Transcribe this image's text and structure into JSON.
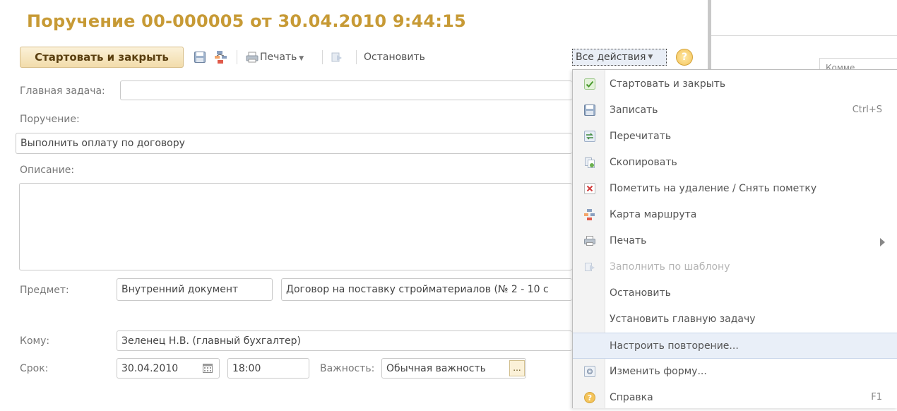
{
  "title": "Поручение 00-000005 от 30.04.2010 9:44:15",
  "toolbar": {
    "start_close": "Стартовать и закрыть",
    "print": "Печать",
    "stop": "Остановить",
    "all_actions": "Все действия",
    "help": "?"
  },
  "form": {
    "main_task_label": "Главная задача:",
    "main_task_value": "",
    "assignment_label": "Поручение:",
    "assignment_value": "Выполнить оплату по договору",
    "description_label": "Описание:",
    "description_value": "",
    "subject_label": "Предмет:",
    "subject_type": "Внутренний документ",
    "subject_value": "Договор на поставку стройматериалов (№ 2 - 10 с",
    "to_label": "Кому:",
    "to_value": "Зеленец Н.В. (главный бухгалтер)",
    "deadline_label": "Срок:",
    "deadline_date": "30.04.2010",
    "deadline_time": "18:00",
    "importance_label": "Важность:",
    "importance_value": "Обычная важность",
    "ellipsis": "..."
  },
  "right_panel": {
    "column_header": "Комме"
  },
  "menu": {
    "items": [
      {
        "label": "Стартовать и закрыть",
        "icon": "check-icon",
        "shortcut": "",
        "disabled": false
      },
      {
        "label": "Записать",
        "icon": "save-icon",
        "shortcut": "Ctrl+S",
        "disabled": false
      },
      {
        "label": "Перечитать",
        "icon": "refresh-icon",
        "shortcut": "",
        "disabled": false
      },
      {
        "label": "Скопировать",
        "icon": "copy-icon",
        "shortcut": "",
        "disabled": false
      },
      {
        "label": "Пометить на удаление / Снять пометку",
        "icon": "delete-mark-icon",
        "shortcut": "",
        "disabled": false
      },
      {
        "label": "Карта маршрута",
        "icon": "route-map-icon",
        "shortcut": "",
        "disabled": false
      },
      {
        "label": "Печать",
        "icon": "printer-icon",
        "shortcut": "",
        "disabled": false
      },
      {
        "label": "Заполнить по шаблону",
        "icon": "template-icon",
        "shortcut": "",
        "disabled": true
      },
      {
        "label": "Остановить",
        "icon": "",
        "shortcut": "",
        "disabled": false
      },
      {
        "label": "Установить главную задачу",
        "icon": "",
        "shortcut": "",
        "disabled": false
      },
      {
        "label": "Настроить повторение...",
        "icon": "",
        "shortcut": "",
        "disabled": false
      },
      {
        "label": "Изменить форму...",
        "icon": "form-settings-icon",
        "shortcut": "",
        "disabled": false
      },
      {
        "label": "Справка",
        "icon": "help-icon",
        "shortcut": "F1",
        "disabled": false
      }
    ]
  },
  "colors": {
    "title": "#c79a35",
    "menu_highlight": "#e9eff8",
    "accent_button": "#f2dcab"
  }
}
